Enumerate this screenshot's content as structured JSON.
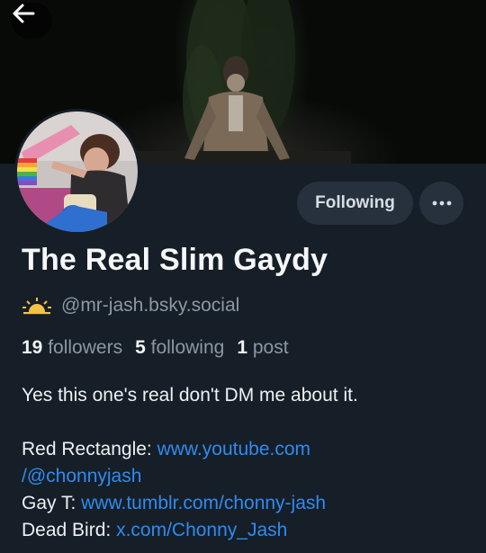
{
  "header": {
    "back_icon": "arrow-left-icon",
    "follow_button_label": "Following",
    "more_icon": "ellipsis-icon"
  },
  "profile": {
    "display_name": "The Real Slim Gaydy",
    "handle_emoji": "sun-icon",
    "handle": "@mr-jash.bsky.social",
    "followers_count": "19",
    "followers_label": "followers",
    "following_count": "5",
    "following_label": "following",
    "posts_count": "1",
    "posts_label": "post"
  },
  "bio": {
    "line1": "Yes this one's real don't DM me about it.",
    "link1_label": "Red Rectangle: ",
    "link1_part1": "www.youtube.com",
    "link1_part2": "/@chonnyjash",
    "link2_label": "Gay T: ",
    "link2_url": "www.tumblr.com/chonny-jash",
    "link3_label": "Dead Bird: ",
    "link3_url": "x.com/Chonny_Jash"
  },
  "colors": {
    "background": "#161e27",
    "button_bg": "#26313d",
    "link": "#2f8bf0",
    "muted_text": "#8c98a4"
  }
}
